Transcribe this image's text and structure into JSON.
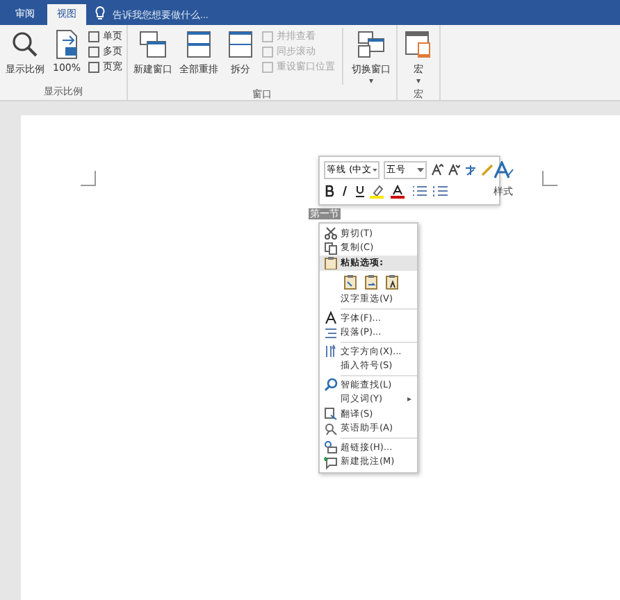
{
  "tabs": [
    {
      "label": "审阅",
      "selected": false
    },
    {
      "label": "视图",
      "selected": true
    }
  ],
  "tell_me": {
    "placeholder": "告诉我您想要做什么..."
  },
  "ribbon_groups": [
    {
      "label": "显示比例",
      "large": [
        {
          "label": "显示比例"
        },
        {
          "label": "100%"
        }
      ],
      "small": [
        {
          "label": "单页",
          "disabled": false
        },
        {
          "label": "多页",
          "disabled": false
        },
        {
          "label": "页宽",
          "disabled": false
        }
      ]
    },
    {
      "label": "窗口",
      "large": [
        {
          "label": "新建窗口"
        },
        {
          "label": "全部重排"
        },
        {
          "label": "拆分"
        }
      ],
      "small": [
        {
          "label": "并排查看",
          "disabled": true
        },
        {
          "label": "同步滚动",
          "disabled": true
        },
        {
          "label": "重设窗口位置",
          "disabled": true
        }
      ],
      "after": [
        {
          "label": "切换窗口",
          "caret": "▾"
        }
      ]
    },
    {
      "label": "宏",
      "large": [
        {
          "label": "宏",
          "caret": "▾"
        }
      ]
    }
  ],
  "selected_text": "第一节",
  "mini_toolbar": {
    "font": "等线 (中文",
    "size": "五号",
    "style_label": "样式"
  },
  "context_menu": [
    {
      "kind": "item",
      "label": "剪切(T)",
      "disabled": false
    },
    {
      "kind": "item",
      "label": "复制(C)",
      "disabled": false
    },
    {
      "kind": "header",
      "label": "粘贴选项:"
    },
    {
      "kind": "paste"
    },
    {
      "kind": "item",
      "label": "汉字重选(V)",
      "disabled": false
    },
    {
      "kind": "separator"
    },
    {
      "kind": "item",
      "label": "字体(F)...",
      "disabled": false
    },
    {
      "kind": "item",
      "label": "段落(P)...",
      "disabled": false
    },
    {
      "kind": "separator"
    },
    {
      "kind": "item",
      "label": "文字方向(X)...",
      "disabled": false
    },
    {
      "kind": "item",
      "label": "插入符号(S)",
      "disabled": false
    },
    {
      "kind": "separator"
    },
    {
      "kind": "item",
      "label": "智能查找(L)",
      "disabled": false
    },
    {
      "kind": "item",
      "label": "同义词(Y)",
      "submenu": "▸",
      "disabled": false
    },
    {
      "kind": "item",
      "label": "翻译(S)",
      "disabled": false
    },
    {
      "kind": "item",
      "label": "英语助手(A)",
      "disabled": false
    },
    {
      "kind": "separator"
    },
    {
      "kind": "item",
      "label": "超链接(H)...",
      "disabled": false
    },
    {
      "kind": "item",
      "label": "新建批注(M)",
      "disabled": false
    }
  ]
}
